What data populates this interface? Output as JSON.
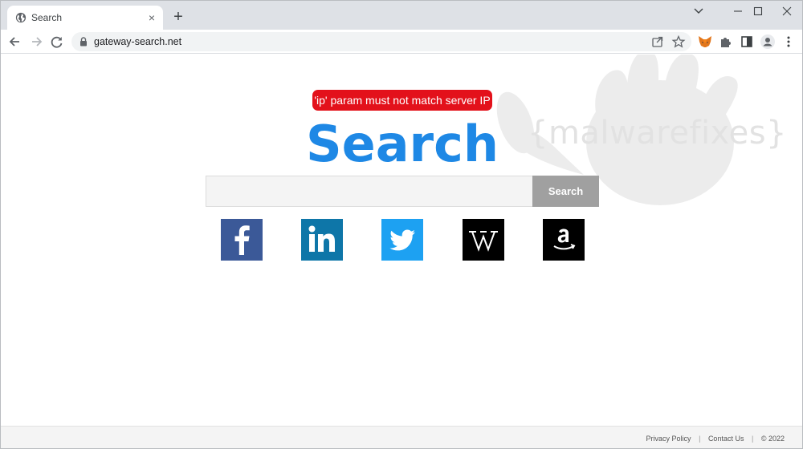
{
  "browser": {
    "tab": {
      "title": "Search",
      "close_glyph": "×"
    },
    "new_tab_glyph": "+",
    "window_controls": {
      "minimize": "—",
      "maximize": "☐",
      "close": "✕"
    },
    "address_bar": {
      "url": "gateway-search.net"
    }
  },
  "page": {
    "error_message": "'ip' param must not match server IP",
    "logo_text": "Search",
    "search": {
      "input_value": "",
      "input_placeholder": "",
      "button_label": "Search"
    },
    "social_links": [
      {
        "name": "facebook",
        "glyph": "f",
        "color": "#3b5998"
      },
      {
        "name": "linkedin",
        "glyph": "in",
        "color": "#0e76a8"
      },
      {
        "name": "twitter",
        "glyph": "twitter-bird",
        "color": "#1da1f2"
      },
      {
        "name": "wikipedia",
        "glyph": "W",
        "color": "#000000"
      },
      {
        "name": "amazon",
        "glyph": "a",
        "color": "#000000"
      }
    ],
    "watermark_text": "{malwarefixes}"
  },
  "footer": {
    "privacy_label": "Privacy Policy",
    "contact_label": "Contact Us",
    "copyright": "© 2022",
    "separator": "|"
  },
  "colors": {
    "accent": "#1e88e5",
    "error": "#e3111b",
    "search_button": "#a0a0a0"
  }
}
